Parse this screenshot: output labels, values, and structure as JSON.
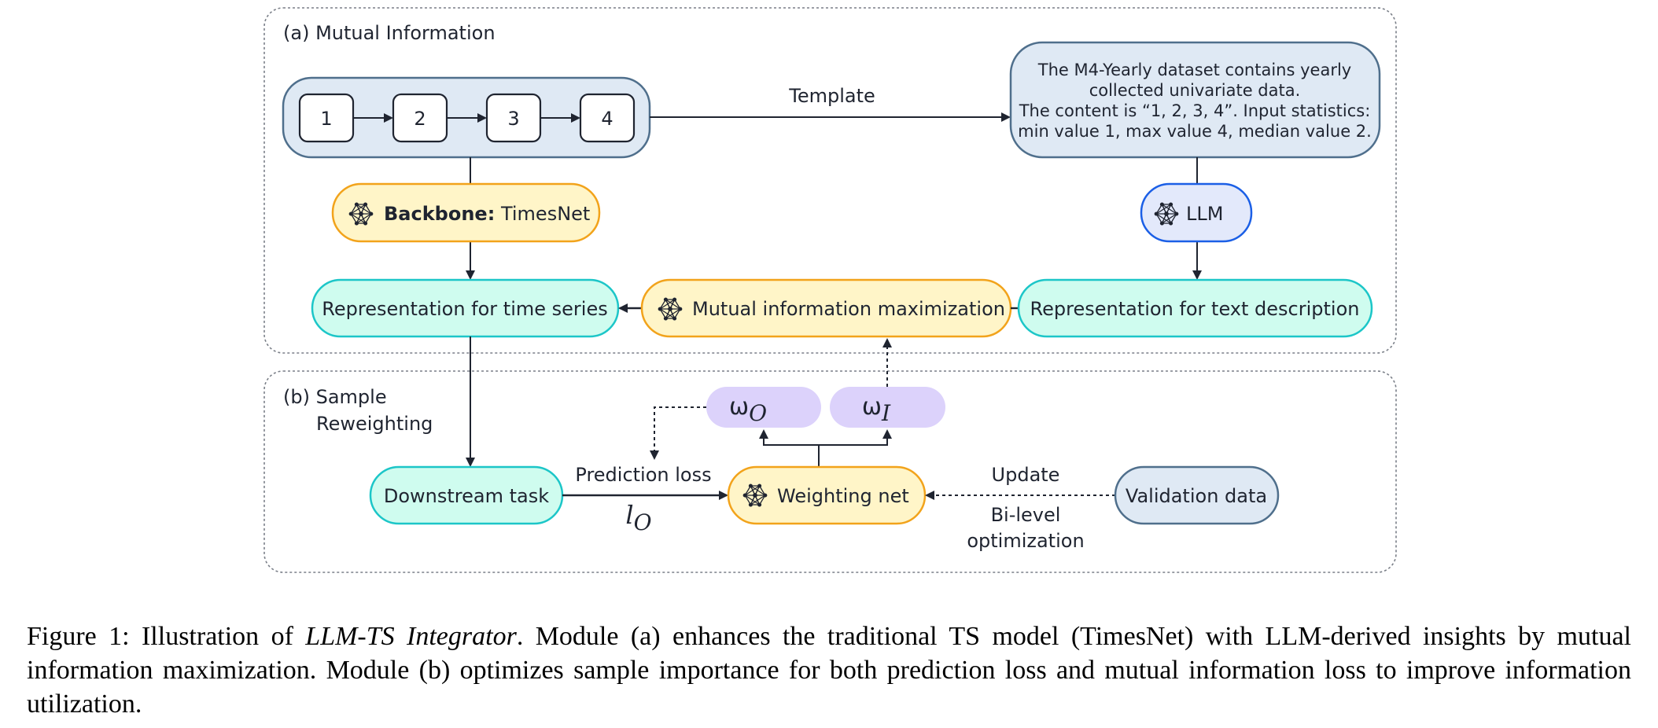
{
  "figure": {
    "section_a": {
      "title": "(a) Mutual Information",
      "input_sequence": [
        "1",
        "2",
        "3",
        "4"
      ],
      "template_label": "Template",
      "text_description": [
        "The M4-Yearly dataset contains yearly",
        "collected univariate data.",
        "The content is “1, 2, 3, 4”. Input statistics:",
        "min value 1, max value 4, median value 2."
      ],
      "backbone": {
        "bold": "Backbone:",
        "name": "TimesNet",
        "icon": "neural-network-icon"
      },
      "llm": {
        "label": "LLM",
        "icon": "neural-network-icon"
      },
      "repr_time_series": "Representation for time series",
      "mi_maximization": {
        "label": "Mutual information maximization",
        "icon": "neural-network-icon"
      },
      "repr_text": "Representation for text description"
    },
    "section_b": {
      "title_line1": "(b) Sample",
      "title_line2": "Reweighting",
      "omega_o": {
        "base": "ω",
        "sub": "O"
      },
      "omega_i": {
        "base": "ω",
        "sub": "I"
      },
      "downstream": "Downstream task",
      "prediction_loss": "Prediction loss",
      "loss_symbol": {
        "base": "l",
        "sub": "O"
      },
      "weighting_net": {
        "label": "Weighting net",
        "icon": "neural-network-icon"
      },
      "update_label": "Update",
      "bilevel_line1": "Bi-level",
      "bilevel_line2": "optimization",
      "validation": "Validation data"
    },
    "colors": {
      "input_fill": "#dfe9f4",
      "input_stroke": "#4f6f8c",
      "orange_fill": "#fff5c8",
      "orange_stroke": "#f2a31b",
      "cyan_fill": "#cffcef",
      "cyan_stroke": "#1cc6c8",
      "llm_fill": "#e3e9fb",
      "llm_stroke": "#1b5fe6",
      "omega_fill": "#dcd2fb"
    }
  },
  "caption": {
    "prefix": "Figure 1: Illustration of ",
    "italic": "LLM-TS Integrator",
    "rest": ". Module (a) enhances the traditional TS model (TimesNet) with LLM-derived insights by mutual information maximization. Module (b) optimizes sample importance for both prediction loss and mutual information loss to improve information utilization."
  }
}
